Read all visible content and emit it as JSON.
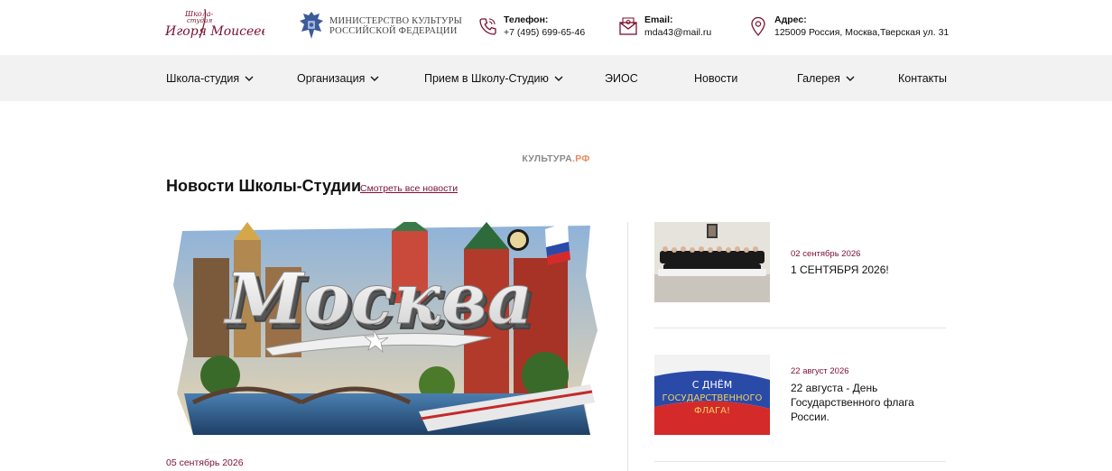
{
  "header": {
    "logo": {
      "line_small_1": "Школа-",
      "line_small_2": "студия",
      "line_main": "Игоря Моисеева"
    },
    "ministry": {
      "line1": "МИНИСТЕРСТВО КУЛЬТУРЫ",
      "line2": "РОССИЙСКОЙ ФЕДЕРАЦИИ"
    },
    "phone": {
      "label": "Телефон:",
      "value": "+7 (495) 699-65-46",
      "icon": "phone-icon"
    },
    "email": {
      "label": "Email:",
      "value": "mda43@mail.ru",
      "icon": "mail-icon"
    },
    "address": {
      "label": "Адрес:",
      "value": "125009 Россия, Москва,Тверская ул. 31",
      "icon": "map-pin-icon"
    }
  },
  "nav": {
    "items": [
      {
        "label": "Школа-студия",
        "has_dropdown": true
      },
      {
        "label": "Организация",
        "has_dropdown": true
      },
      {
        "label": "Прием в Школу-Студию",
        "has_dropdown": true
      },
      {
        "label": "ЭИОС",
        "has_dropdown": false
      },
      {
        "label": "Новости",
        "has_dropdown": false
      },
      {
        "label": "Галерея",
        "has_dropdown": true
      },
      {
        "label": "Контакты",
        "has_dropdown": false
      }
    ]
  },
  "kultura": {
    "main": "КУЛЬТУРА",
    "suffix": ".РФ"
  },
  "news": {
    "section_title": "Новости Школы-Студии",
    "see_all": "Смотреть все новости",
    "main": {
      "image_text": "Москва",
      "date": "05 сентябрь 2026"
    },
    "side": [
      {
        "date": "02 сентябрь 2026",
        "title": "1 СЕНТЯБРЯ 2026!"
      },
      {
        "date": "22 август 2026",
        "title": "22 августа - День Государственного флага России.",
        "image_text_1": "С ДНЁМ",
        "image_text_2": "ГОСУДАРСТВЕННОГО",
        "image_text_3": "ФЛАГА!"
      }
    ]
  },
  "colors": {
    "accent": "#7a1030",
    "nav_bg": "#f2f2f2",
    "kultura_rf": "#e8895a"
  }
}
